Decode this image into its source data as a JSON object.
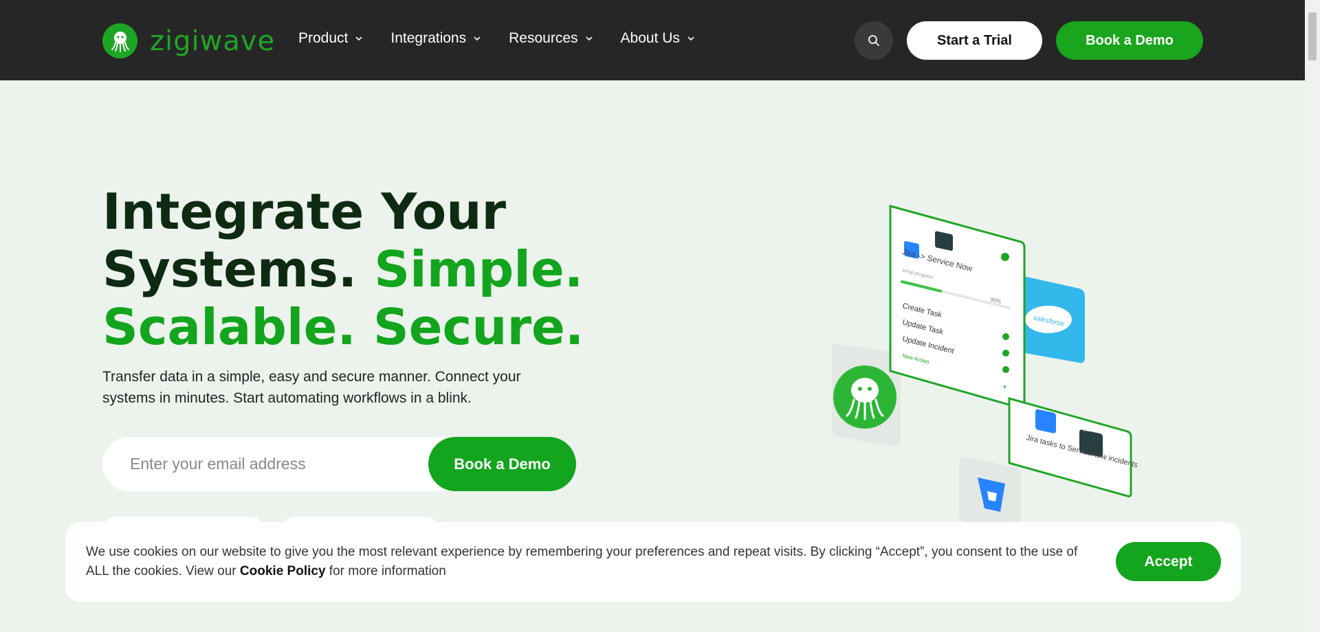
{
  "header": {
    "logo_text": "zigiwave",
    "nav": [
      {
        "label": "Product"
      },
      {
        "label": "Integrations"
      },
      {
        "label": "Resources"
      },
      {
        "label": "About Us"
      }
    ],
    "trial_label": "Start a Trial",
    "demo_label": "Book a Demo"
  },
  "hero": {
    "headline_line1": "Integrate Your",
    "headline_line2a": "Systems. ",
    "headline_line2b": "Simple.",
    "headline_line3": "Scalable. Secure.",
    "subtext": "Transfer data in a simple, easy and secure manner. Connect your systems in minutes. Start automating workflows in a blink.",
    "email_placeholder": "Enter your email address",
    "form_button": "Book a Demo"
  },
  "illustration": {
    "card1_title": "Jira -> Service Now",
    "progress_label": "setup progress",
    "progress_value": "90%",
    "progress_fraction": 0.9,
    "actions": [
      "Create Task",
      "Update Task",
      "Update Incident"
    ],
    "new_action": "New Action",
    "card2_text": "Jira tasks to ServiceNow incidents",
    "salesforce_label": "salesforce",
    "now_label": "now"
  },
  "cookie": {
    "text_before": "We use cookies on our website to give you the most relevant experience by remembering your preferences and repeat visits. By clicking “Accept”, you consent to the use of ALL the cookies. View our ",
    "policy_link": "Cookie Policy",
    "text_after": " for more information",
    "accept_label": "Accept"
  },
  "colors": {
    "brand_green": "#13a51d",
    "header_bg": "#262626",
    "page_bg": "#ecf3ec"
  }
}
